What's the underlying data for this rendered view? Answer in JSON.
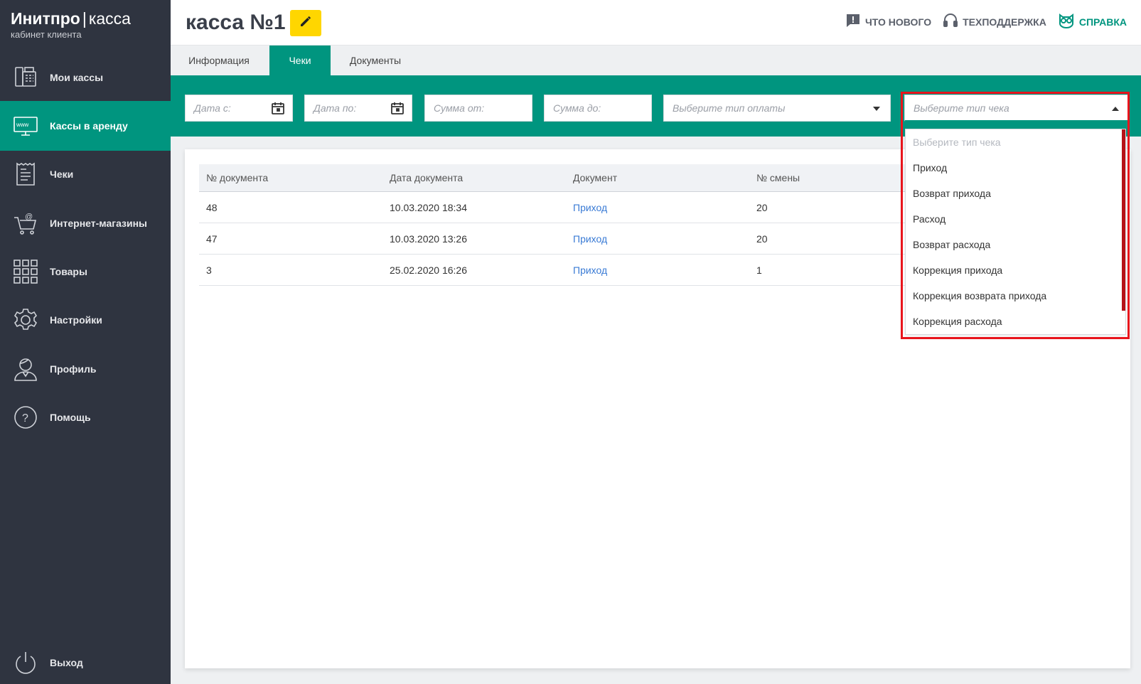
{
  "brand": {
    "name_bold": "Инитпро",
    "separator": "|",
    "name_light": "касса",
    "subtitle": "кабинет клиента"
  },
  "sidebar": {
    "items": [
      {
        "label": "Мои кассы",
        "icon": "cash-register-icon"
      },
      {
        "label": "Кассы в аренду",
        "icon": "www-monitor-icon",
        "active": true
      },
      {
        "label": "Чеки",
        "icon": "receipt-icon"
      },
      {
        "label": "Интернет-магазины",
        "icon": "cart-at-icon"
      },
      {
        "label": "Товары",
        "icon": "grid-icon"
      },
      {
        "label": "Настройки",
        "icon": "gear-icon"
      },
      {
        "label": "Профиль",
        "icon": "user-icon"
      },
      {
        "label": "Помощь",
        "icon": "question-circle-icon"
      }
    ],
    "logout": {
      "label": "Выход",
      "icon": "power-icon"
    }
  },
  "header": {
    "title": "касса №1",
    "links": {
      "news": "ЧТО НОВОГО",
      "support": "ТЕХПОДДЕРЖКА",
      "help": "СПРАВКА"
    }
  },
  "tabs": [
    {
      "label": "Информация"
    },
    {
      "label": "Чеки",
      "active": true
    },
    {
      "label": "Документы"
    }
  ],
  "filters": {
    "date_from": "Дата с:",
    "date_to": "Дата по:",
    "sum_from": "Сумма от:",
    "sum_to": "Сумма до:",
    "payment_type": "Выберите тип оплаты",
    "check_type": "Выберите тип чека"
  },
  "table": {
    "headers": [
      "№ документа",
      "Дата документа",
      "Документ",
      "№ смены"
    ],
    "rows": [
      {
        "num": "48",
        "date": "10.03.2020 18:34",
        "doc": "Приход",
        "shift": "20"
      },
      {
        "num": "47",
        "date": "10.03.2020 13:26",
        "doc": "Приход",
        "shift": "20"
      },
      {
        "num": "3",
        "date": "25.02.2020 16:26",
        "doc": "Приход",
        "shift": "1"
      }
    ]
  },
  "check_type_options": [
    "Выберите тип чека",
    "Приход",
    "Возврат прихода",
    "Расход",
    "Возврат расхода",
    "Коррекция прихода",
    "Коррекция возврата прихода",
    "Коррекция расхода"
  ],
  "colors": {
    "accent": "#00957f",
    "sidebar": "#2f3440",
    "highlight": "#e8141c",
    "edit_button": "#ffd600",
    "link": "#3a7bd5"
  }
}
